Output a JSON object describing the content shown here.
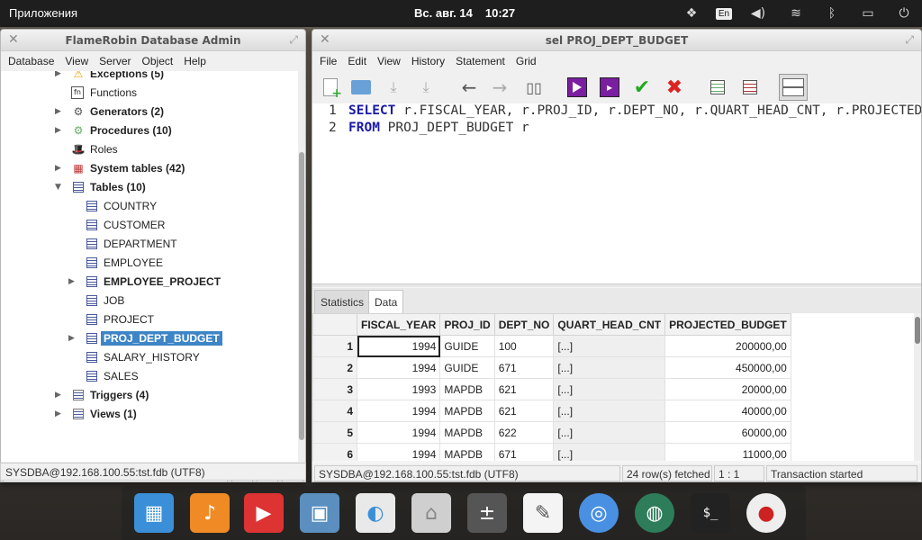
{
  "top_panel": {
    "apps_label": "Приложения",
    "date": "Вс. авг. 14",
    "time": "10:27",
    "lang": "En"
  },
  "left_window": {
    "title": "FlameRobin Database Admin",
    "menu": [
      "Database",
      "View",
      "Server",
      "Object",
      "Help"
    ],
    "tree": [
      {
        "label": "Exceptions (5)",
        "bold": true,
        "icon": "warning-icon"
      },
      {
        "label": "Functions",
        "bold": false,
        "icon": "function-icon"
      },
      {
        "label": "Generators (2)",
        "bold": true,
        "icon": "generator-icon"
      },
      {
        "label": "Procedures (10)",
        "bold": true,
        "icon": "procedure-icon"
      },
      {
        "label": "Roles",
        "bold": false,
        "icon": "roles-icon"
      },
      {
        "label": "System tables (42)",
        "bold": true,
        "icon": "system-table-icon"
      },
      {
        "label": "Tables (10)",
        "bold": true,
        "icon": "tables-icon"
      },
      {
        "label": "COUNTRY",
        "bold": false,
        "icon": "table-icon"
      },
      {
        "label": "CUSTOMER",
        "bold": false,
        "icon": "table-icon"
      },
      {
        "label": "DEPARTMENT",
        "bold": false,
        "icon": "table-icon"
      },
      {
        "label": "EMPLOYEE",
        "bold": false,
        "icon": "table-icon"
      },
      {
        "label": "EMPLOYEE_PROJECT",
        "bold": true,
        "icon": "table-icon"
      },
      {
        "label": "JOB",
        "bold": false,
        "icon": "table-icon"
      },
      {
        "label": "PROJECT",
        "bold": false,
        "icon": "table-icon"
      },
      {
        "label": "PROJ_DEPT_BUDGET",
        "bold": true,
        "icon": "table-icon",
        "selected": true
      },
      {
        "label": "SALARY_HISTORY",
        "bold": false,
        "icon": "table-icon"
      },
      {
        "label": "SALES",
        "bold": false,
        "icon": "table-icon"
      },
      {
        "label": "Triggers (4)",
        "bold": true,
        "icon": "trigger-icon"
      },
      {
        "label": "Views (1)",
        "bold": true,
        "icon": "views-icon"
      }
    ],
    "search_value": "",
    "status": "SYSDBA@192.168.100.55:tst.fdb (UTF8)"
  },
  "right_window": {
    "title": "sel PROJ_DEPT_BUDGET",
    "menu": [
      "File",
      "Edit",
      "View",
      "History",
      "Statement",
      "Grid"
    ],
    "sql_lines": [
      {
        "num": "1",
        "kw": "SELECT",
        "rest": " r.FISCAL_YEAR, r.PROJ_ID, r.DEPT_NO, r.QUART_HEAD_CNT, r.PROJECTED_BUDGET"
      },
      {
        "num": "2",
        "kw": "FROM",
        "rest": " PROJ_DEPT_BUDGET r"
      }
    ],
    "tabs": [
      "Statistics",
      "Data"
    ],
    "active_tab": "Data",
    "columns": [
      "FISCAL_YEAR",
      "PROJ_ID",
      "DEPT_NO",
      "QUART_HEAD_CNT",
      "PROJECTED_BUDGET"
    ],
    "rows": [
      [
        "1",
        "1994",
        "GUIDE",
        "100",
        "[...]",
        "200000,00"
      ],
      [
        "2",
        "1994",
        "GUIDE",
        "671",
        "[...]",
        "450000,00"
      ],
      [
        "3",
        "1993",
        "MAPDB",
        "621",
        "[...]",
        "20000,00"
      ],
      [
        "4",
        "1994",
        "MAPDB",
        "621",
        "[...]",
        "40000,00"
      ],
      [
        "5",
        "1994",
        "MAPDB",
        "622",
        "[...]",
        "60000,00"
      ],
      [
        "6",
        "1994",
        "MAPDB",
        "671",
        "[...]",
        "11000,00"
      ]
    ],
    "status": {
      "connection": "SYSDBA@192.168.100.55:tst.fdb (UTF8)",
      "rows_fetched": "24 row(s) fetched",
      "cursor": "1 : 1",
      "transaction": "Transaction started"
    }
  },
  "dock": [
    "multitasking-view",
    "music",
    "videos",
    "photos",
    "switchboard",
    "files",
    "calculator",
    "scratch-text-editor",
    "chromium",
    "web-browser",
    "terminal",
    "flamerobin"
  ]
}
